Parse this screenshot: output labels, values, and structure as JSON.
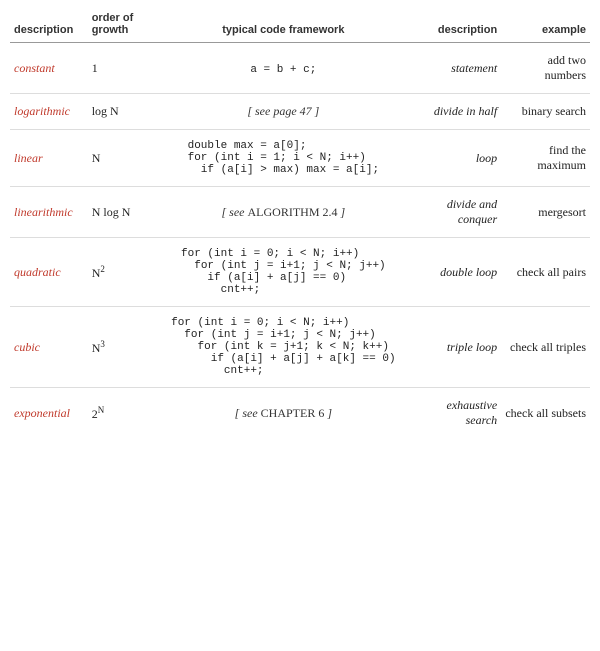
{
  "header": {
    "col1": "description",
    "col2": "order of\ngrowth",
    "col3": "typical code framework",
    "col4": "description",
    "col5": "example"
  },
  "rows": [
    {
      "id": "constant",
      "desc": "constant",
      "order": "1",
      "order_html": "1",
      "code": "a = b + c;",
      "code_type": "code",
      "desc2": "statement",
      "example": "add two numbers"
    },
    {
      "id": "logarithmic",
      "desc": "logarithmic",
      "order": "log N",
      "code": "[ see page 47 ]",
      "code_type": "ref",
      "desc2": "divide in half",
      "example": "binary search"
    },
    {
      "id": "linear",
      "desc": "linear",
      "order": "N",
      "code": "double max = a[0];\nfor (int i = 1; i < N; i++)\n  if (a[i] > max) max = a[i];",
      "code_type": "code",
      "desc2": "loop",
      "example": "find the maximum"
    },
    {
      "id": "linearithmic",
      "desc": "linearithmic",
      "order": "N log N",
      "code": "[ see ALGORITHM 2.4 ]",
      "code_type": "ref_algo",
      "desc2": "divide and conquer",
      "example": "mergesort"
    },
    {
      "id": "quadratic",
      "desc": "quadratic",
      "order": "N²",
      "code": "for (int i = 0; i < N; i++)\n  for (int j = i+1; j < N; j++)\n    if (a[i] + a[j] == 0)\n      cnt++;",
      "code_type": "code",
      "desc2": "double loop",
      "example": "check all pairs"
    },
    {
      "id": "cubic",
      "desc": "cubic",
      "order": "N³",
      "code": "for (int i = 0; i < N; i++)\n  for (int j = i+1; j < N; j++)\n    for (int k = j+1; k < N; k++)\n      if (a[i] + a[j] + a[k] == 0)\n        cnt++;",
      "code_type": "code",
      "desc2": "triple loop",
      "example": "check all triples"
    },
    {
      "id": "exponential",
      "desc": "exponential",
      "order": "2^N",
      "code": "[ see CHAPTER 6 ]",
      "code_type": "ref_algo",
      "desc2": "exhaustive search",
      "example": "check all subsets"
    }
  ]
}
